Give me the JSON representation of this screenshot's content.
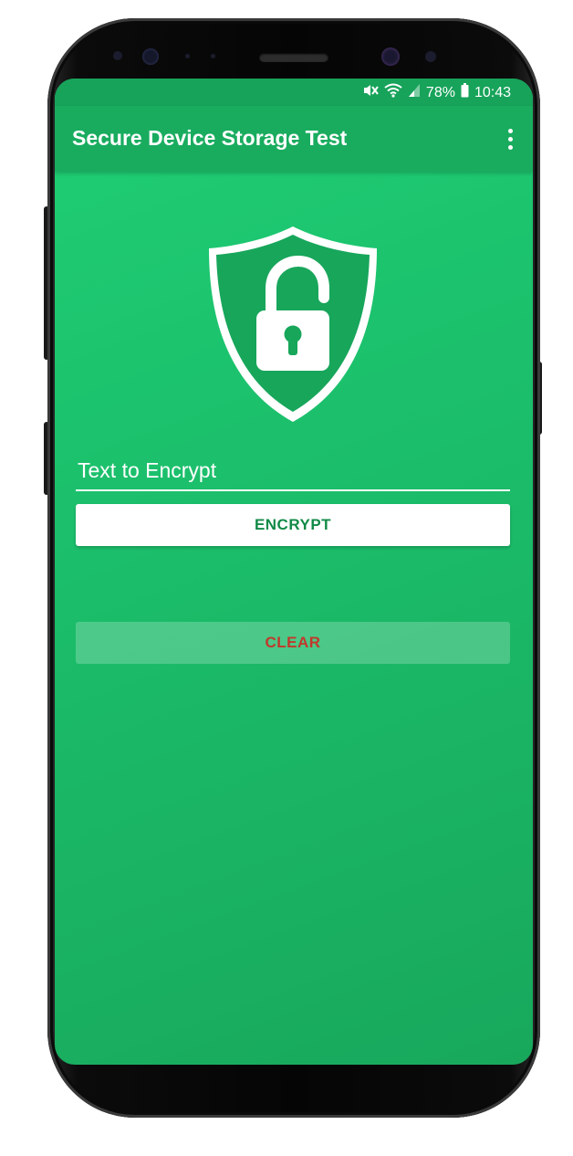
{
  "status_bar": {
    "battery": "78%",
    "time": "10:43",
    "icons": [
      "mute-icon",
      "wifi-icon",
      "signal-icon",
      "battery-icon"
    ]
  },
  "app_bar": {
    "title": "Secure Device Storage Test",
    "menu_icon": "overflow-menu-icon"
  },
  "hero": {
    "icon": "shield-unlocked-padlock-icon"
  },
  "form": {
    "input_placeholder": "Text to Encrypt",
    "input_value": "",
    "encrypt_label": "ENCRYPT",
    "clear_label": "CLEAR"
  },
  "colors": {
    "primary": "#19ac5f",
    "primary_dark": "#17a35a",
    "background": "#1fce74",
    "encrypt_text": "#128a47",
    "clear_text": "#c0392b"
  }
}
